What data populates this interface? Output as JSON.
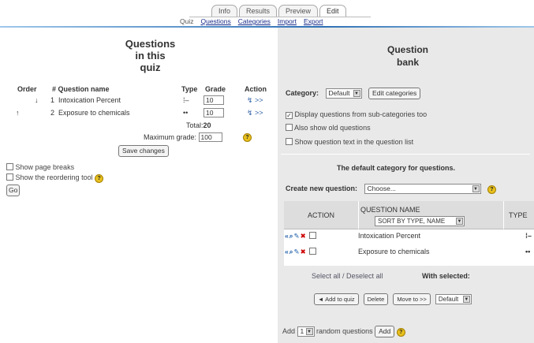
{
  "tabs": [
    "Info",
    "Results",
    "Preview",
    "Edit"
  ],
  "subtabs": [
    "Quiz",
    "Questions",
    "Categories",
    "Import",
    "Export"
  ],
  "left": {
    "title_lines": [
      "Questions",
      "in this",
      "quiz"
    ],
    "headers": {
      "order": "Order",
      "name": "# Question name",
      "type": "Type",
      "grade": "Grade",
      "action": "Action"
    },
    "rows": [
      {
        "arrow": "↓",
        "num": "1",
        "name": "Intoxication Percent",
        "type": "⁞–",
        "grade": "10",
        "action": "↯ >>"
      },
      {
        "arrow": "↑",
        "num": "2",
        "name": "Exposure to chemicals",
        "type": "••",
        "grade": "10",
        "action": "↯ >>"
      }
    ],
    "total_label": "Total:",
    "total_value": "20",
    "max_grade_label": "Maximum grade:",
    "max_grade_value": "100",
    "save_button": "Save changes",
    "show_page_breaks": "Show page breaks",
    "show_reordering_tool": "Show the reordering tool",
    "go_button": "Go"
  },
  "right": {
    "title_lines": [
      "Question",
      "bank"
    ],
    "category_label": "Category:",
    "category_value": "Default",
    "edit_categories": "Edit categories",
    "opt_subcats": "Display questions from sub-categories too",
    "opt_old": "Also show old questions",
    "opt_text": "Show question text in the question list",
    "default_category_text": "The default category for questions.",
    "create_label": "Create new question:",
    "create_value": "Choose...",
    "table": {
      "action_header": "ACTION",
      "name_header": "QUESTION NAME",
      "sort_value": "SORT BY TYPE, NAME",
      "type_header": "TYPE",
      "rows": [
        {
          "name": "Intoxication Percent",
          "type": "⁞–"
        },
        {
          "name": "Exposure to chemicals",
          "type": "••"
        }
      ]
    },
    "select_all": "Select all",
    "slash": " / ",
    "deselect_all": "Deselect all",
    "with_selected": "With selected:",
    "add_to_quiz": "◄ Add to quiz",
    "delete": "Delete",
    "move_to": "Move to >>",
    "move_target": "Default",
    "add_label": "Add",
    "random_count": "1",
    "random_label": "random questions",
    "add_button": "Add"
  },
  "icons": {
    "help": "help-icon",
    "checkbox": "checkbox-icon"
  },
  "colors": {
    "link": "#1b2e8a",
    "accent": "#2c6fb3",
    "help": "#e8c01e",
    "delete": "#cc0000"
  }
}
